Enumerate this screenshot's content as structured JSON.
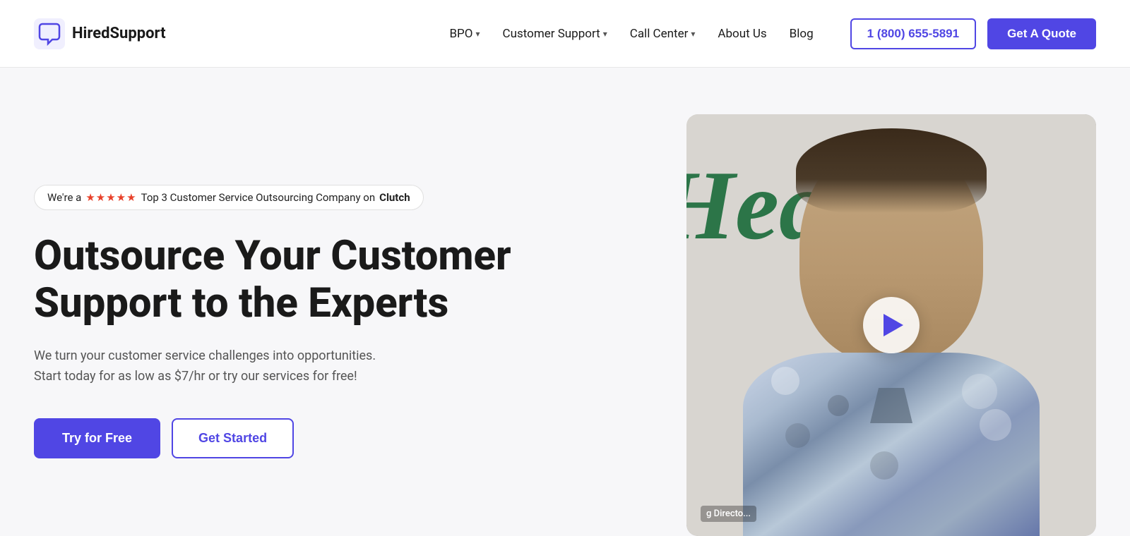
{
  "brand": {
    "name": "HiredSupport",
    "logo_alt": "HiredSupport chat icon"
  },
  "nav": {
    "links": [
      {
        "label": "BPO",
        "has_dropdown": true
      },
      {
        "label": "Customer Support",
        "has_dropdown": true
      },
      {
        "label": "Call Center",
        "has_dropdown": true
      },
      {
        "label": "About Us",
        "has_dropdown": false
      },
      {
        "label": "Blog",
        "has_dropdown": false
      }
    ],
    "phone": "1 (800) 655-5891",
    "quote_label": "Get A Quote"
  },
  "hero": {
    "badge": {
      "prefix": "We're a",
      "stars": "★★★★★",
      "suffix": "Top 3 Customer Service Outsourcing Company on",
      "platform": "Clutch"
    },
    "title": "Outsource Your Customer Support to the Experts",
    "description": "We turn your customer service challenges into opportunities. Start today for as low as $7/hr or try our services for free!",
    "cta_primary": "Try for Free",
    "cta_secondary": "Get Started"
  },
  "video": {
    "caption": "g Directo...",
    "play_label": "Play video"
  }
}
